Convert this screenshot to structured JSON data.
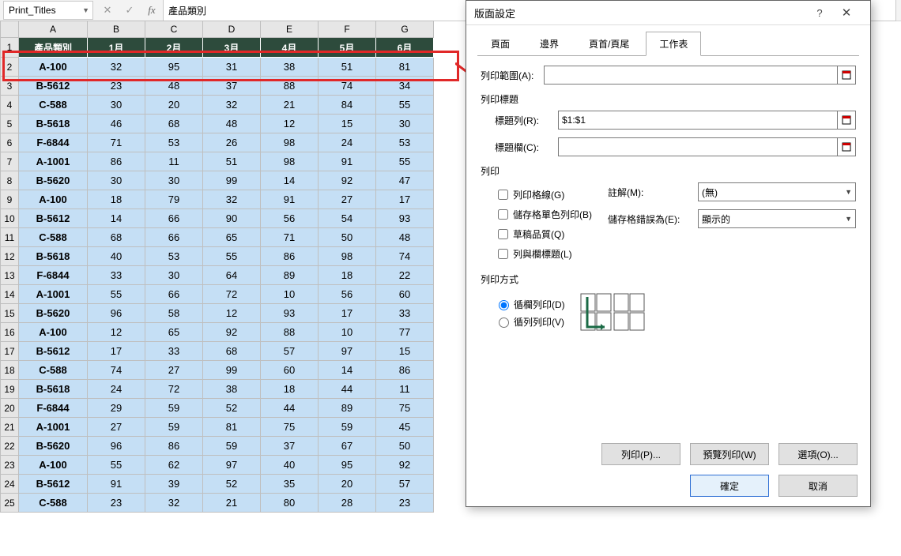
{
  "formula_bar": {
    "namebox_value": "Print_Titles",
    "cancel_glyph": "✕",
    "enter_glyph": "✓",
    "fx_glyph": "fx",
    "formula_value": "產品類別"
  },
  "columns": [
    "A",
    "B",
    "C",
    "D",
    "E",
    "F",
    "G"
  ],
  "header_row": [
    "產品類別",
    "1月",
    "2月",
    "3月",
    "4月",
    "5月",
    "6月"
  ],
  "rows": [
    {
      "n": 2,
      "p": "A-100",
      "v": [
        32,
        95,
        31,
        38,
        51,
        81
      ]
    },
    {
      "n": 3,
      "p": "B-5612",
      "v": [
        23,
        48,
        37,
        88,
        74,
        34
      ]
    },
    {
      "n": 4,
      "p": "C-588",
      "v": [
        30,
        20,
        32,
        21,
        84,
        55
      ]
    },
    {
      "n": 5,
      "p": "B-5618",
      "v": [
        46,
        68,
        48,
        12,
        15,
        30
      ]
    },
    {
      "n": 6,
      "p": "F-6844",
      "v": [
        71,
        53,
        26,
        98,
        24,
        53
      ]
    },
    {
      "n": 7,
      "p": "A-1001",
      "v": [
        86,
        11,
        51,
        98,
        91,
        55
      ]
    },
    {
      "n": 8,
      "p": "B-5620",
      "v": [
        30,
        30,
        99,
        14,
        92,
        47
      ]
    },
    {
      "n": 9,
      "p": "A-100",
      "v": [
        18,
        79,
        32,
        91,
        27,
        17
      ]
    },
    {
      "n": 10,
      "p": "B-5612",
      "v": [
        14,
        66,
        90,
        56,
        54,
        93
      ]
    },
    {
      "n": 11,
      "p": "C-588",
      "v": [
        68,
        66,
        65,
        71,
        50,
        48
      ]
    },
    {
      "n": 12,
      "p": "B-5618",
      "v": [
        40,
        53,
        55,
        86,
        98,
        74
      ]
    },
    {
      "n": 13,
      "p": "F-6844",
      "v": [
        33,
        30,
        64,
        89,
        18,
        22
      ]
    },
    {
      "n": 14,
      "p": "A-1001",
      "v": [
        55,
        66,
        72,
        10,
        56,
        60
      ]
    },
    {
      "n": 15,
      "p": "B-5620",
      "v": [
        96,
        58,
        12,
        93,
        17,
        33
      ]
    },
    {
      "n": 16,
      "p": "A-100",
      "v": [
        12,
        65,
        92,
        88,
        10,
        77
      ]
    },
    {
      "n": 17,
      "p": "B-5612",
      "v": [
        17,
        33,
        68,
        57,
        97,
        15
      ]
    },
    {
      "n": 18,
      "p": "C-588",
      "v": [
        74,
        27,
        99,
        60,
        14,
        86
      ]
    },
    {
      "n": 19,
      "p": "B-5618",
      "v": [
        24,
        72,
        38,
        18,
        44,
        11
      ]
    },
    {
      "n": 20,
      "p": "F-6844",
      "v": [
        29,
        59,
        52,
        44,
        89,
        75
      ]
    },
    {
      "n": 21,
      "p": "A-1001",
      "v": [
        27,
        59,
        81,
        75,
        59,
        45
      ]
    },
    {
      "n": 22,
      "p": "B-5620",
      "v": [
        96,
        86,
        59,
        37,
        67,
        50
      ]
    },
    {
      "n": 23,
      "p": "A-100",
      "v": [
        55,
        62,
        97,
        40,
        95,
        92
      ]
    },
    {
      "n": 24,
      "p": "B-5612",
      "v": [
        91,
        39,
        52,
        35,
        20,
        57
      ]
    },
    {
      "n": 25,
      "p": "C-588",
      "v": [
        23,
        32,
        21,
        80,
        28,
        23
      ]
    }
  ],
  "dialog": {
    "title": "版面設定",
    "help": "?",
    "close": "✕",
    "tabs": [
      "頁面",
      "邊界",
      "頁首/頁尾",
      "工作表"
    ],
    "active_tab": 3,
    "print_area_label": "列印範圍(A):",
    "print_area_value": "",
    "print_titles_section": "列印標題",
    "rows_repeat_label": "標題列(R):",
    "rows_repeat_value": "$1:$1",
    "cols_repeat_label": "標題欄(C):",
    "cols_repeat_value": "",
    "print_section": "列印",
    "chk_gridlines": "列印格線(G)",
    "chk_bw": "儲存格單色列印(B)",
    "chk_draft": "草稿品質(Q)",
    "chk_rowcol": "列與欄標題(L)",
    "comments_label": "註解(M):",
    "comments_value": "(無)",
    "errors_label": "儲存格錯誤為(E):",
    "errors_value": "顯示的",
    "order_section": "列印方式",
    "order_down": "循欄列印(D)",
    "order_over": "循列列印(V)",
    "btn_print": "列印(P)...",
    "btn_preview": "預覽列印(W)",
    "btn_options": "選項(O)...",
    "btn_ok": "確定",
    "btn_cancel": "取消"
  }
}
